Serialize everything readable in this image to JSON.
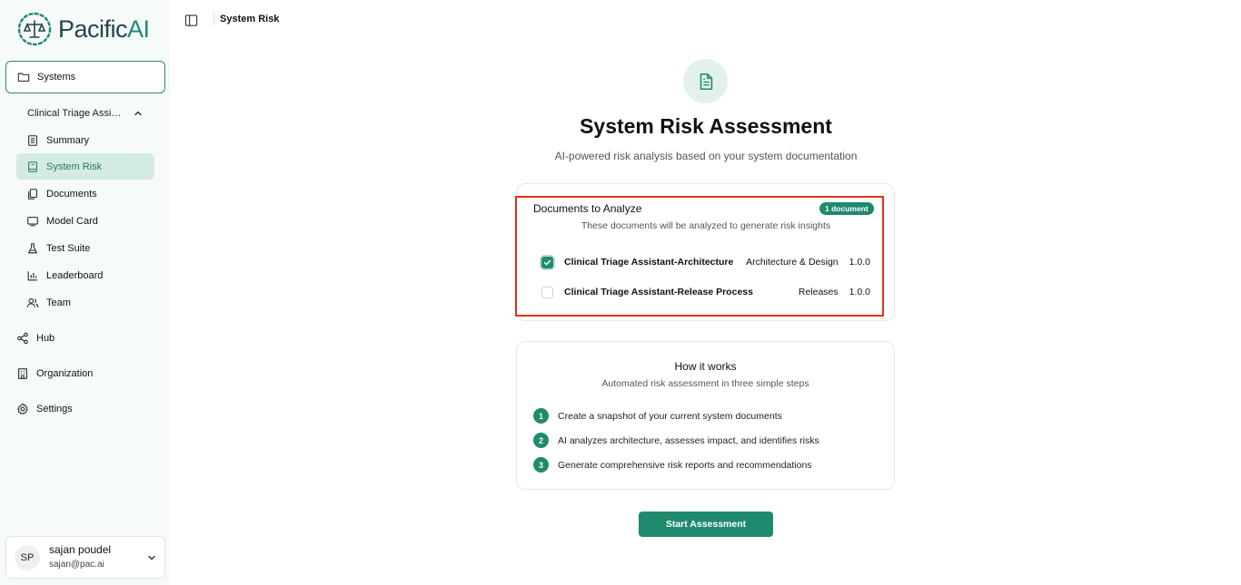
{
  "brand": {
    "name": "Pacific",
    "name_accent": "AI"
  },
  "sidebar": {
    "systems_label": "Systems",
    "system_name": "Clinical Triage Assistant",
    "sub_items": [
      {
        "label": "Summary",
        "icon": "notebook-icon"
      },
      {
        "label": "System Risk",
        "icon": "book-icon",
        "active": true
      },
      {
        "label": "Documents",
        "icon": "files-icon"
      },
      {
        "label": "Model Card",
        "icon": "monitor-icon"
      },
      {
        "label": "Test Suite",
        "icon": "flask-icon"
      },
      {
        "label": "Leaderboard",
        "icon": "bar-chart-icon"
      },
      {
        "label": "Team",
        "icon": "users-icon"
      }
    ],
    "main_items": [
      {
        "label": "Hub",
        "icon": "share-icon"
      },
      {
        "label": "Organization",
        "icon": "building-icon"
      },
      {
        "label": "Settings",
        "icon": "gear-icon"
      }
    ]
  },
  "user": {
    "initials": "SP",
    "name": "sajan poudel",
    "email": "sajan@pac.ai"
  },
  "header": {
    "breadcrumb": "System Risk"
  },
  "hero": {
    "title": "System Risk Assessment",
    "subtitle": "AI-powered risk analysis based on your system documentation"
  },
  "documents": {
    "title": "Documents to Analyze",
    "badge": "1 document",
    "subtitle": "These documents will be analyzed to generate risk insights",
    "rows": [
      {
        "name": "Clinical Triage Assistant-Architecture",
        "category": "Architecture & Design",
        "version": "1.0.0",
        "checked": true
      },
      {
        "name": "Clinical Triage Assistant-Release Process",
        "category": "Releases",
        "version": "1.0.0",
        "checked": false
      }
    ]
  },
  "how": {
    "title": "How it works",
    "subtitle": "Automated risk assessment in three simple steps",
    "steps": [
      {
        "num": "1",
        "text": "Create a snapshot of your current system documents"
      },
      {
        "num": "2",
        "text": "AI analyzes architecture, assesses impact, and identifies risks"
      },
      {
        "num": "3",
        "text": "Generate comprehensive risk reports and recommendations"
      }
    ]
  },
  "actions": {
    "start_label": "Start Assessment"
  },
  "colors": {
    "accent": "#1f8a6e",
    "highlight": "#e0301e",
    "active_bg": "#d4ebe3"
  }
}
